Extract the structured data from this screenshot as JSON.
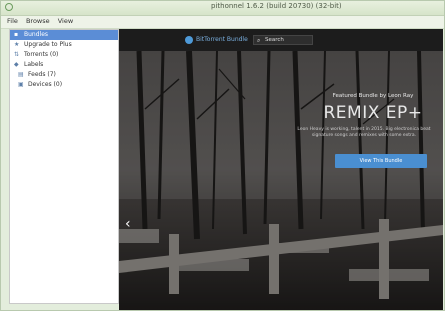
{
  "window": {
    "title": "pithonnel 1.6.2 (build 20730) (32-bit)"
  },
  "menu": [
    "File",
    "Browse",
    "View"
  ],
  "sidebar": {
    "items": [
      {
        "label": "Bundles",
        "icon": "box-icon"
      },
      {
        "label": "Upgrade to Plus",
        "icon": "star-icon"
      },
      {
        "label": "Torrents (0)",
        "icon": "torrent-icon"
      },
      {
        "label": "Labels",
        "icon": "tag-icon"
      },
      {
        "label": "Feeds (7)",
        "icon": "feed-icon"
      },
      {
        "label": "Devices (0)",
        "icon": "device-icon"
      }
    ],
    "selected_index": 0
  },
  "content": {
    "logo_text": "BitTorrent Bundle",
    "search_placeholder": "Search",
    "featured_label": "Featured Bundle by Leon Ray",
    "hero_title": "REMIX EP+",
    "hero_description": "Leon Heavy is working, talent in 2015. Big electronica beat signature songs and remixes with some extra.",
    "cta_label": "View This Bundle",
    "prev_arrow": "‹"
  },
  "colors": {
    "selection": "#5b8dd6",
    "cta": "#4a8fd1",
    "window_chrome": "#d7e5cf"
  }
}
